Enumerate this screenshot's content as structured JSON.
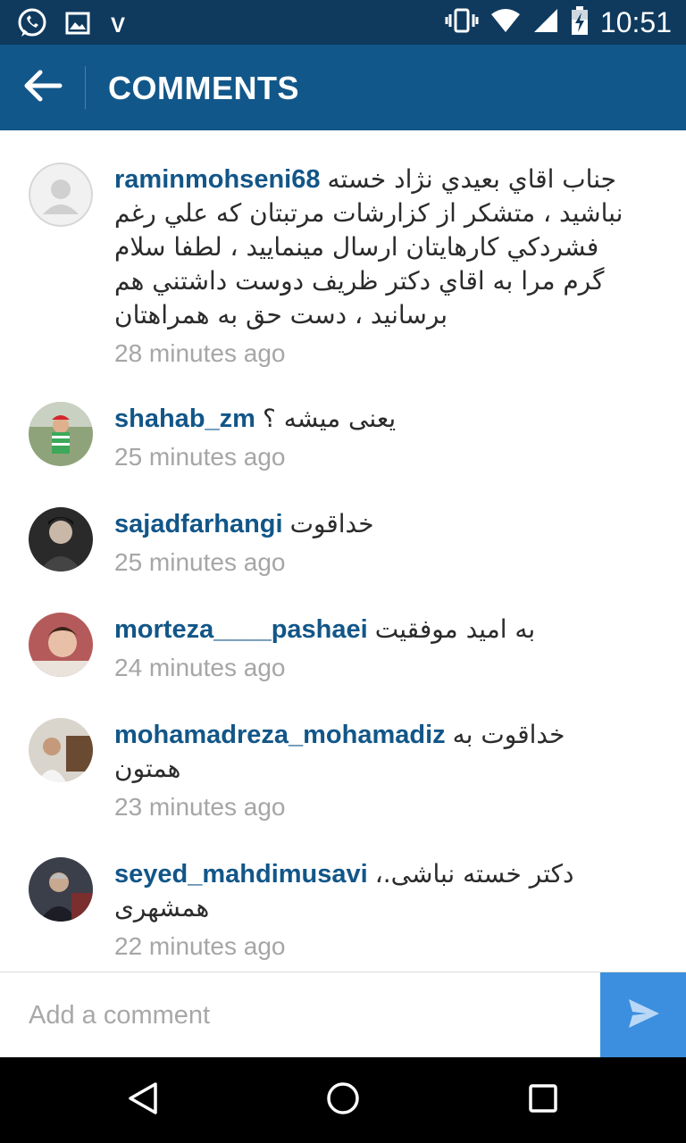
{
  "status_bar": {
    "time": "10:51",
    "carrier_mark": "V",
    "left_icons": [
      "whatsapp-icon",
      "image-icon"
    ],
    "right_icons": [
      "vibrate-icon",
      "wifi-icon",
      "signal-icon",
      "battery-charging-icon"
    ]
  },
  "toolbar": {
    "title": "COMMENTS",
    "back_icon": "arrow-left-icon"
  },
  "comments": [
    {
      "username": "raminmohseni68",
      "text": "جناب اقاي بعيدي نژاد خسته نباشيد ، متشكر از كزارشات مرتبتان كه علي رغم فشردكي كارهايتان ارسال مينماييد ، لطفا سلام گرم مرا به اقاي دكتر ظريف دوست داشتني هم برسانيد ، دست حق به همراهتان",
      "time": "28 minutes ago",
      "avatar": "default-avatar"
    },
    {
      "username": "shahab_zm",
      "text": "یعنی میشه ؟",
      "time": "25 minutes ago",
      "avatar": "child-photo"
    },
    {
      "username": "sajadfarhangi",
      "text": "خداقوت",
      "time": "25 minutes ago",
      "avatar": "man-photo"
    },
    {
      "username": "morteza____pashaei",
      "text": "به امید موفقیت",
      "time": "24 minutes ago",
      "avatar": "child-photo"
    },
    {
      "username": "mohamadreza_mohamadiz",
      "text": "خداقوت به همتون",
      "time": "23 minutes ago",
      "avatar": "man-photo"
    },
    {
      "username": "seyed_mahdimusavi",
      "text": "دکتر خسته نباشی.، همشهری",
      "time": "22 minutes ago",
      "avatar": "man-photo"
    }
  ],
  "composer": {
    "placeholder": "Add a comment",
    "value": "",
    "send_icon": "send-icon"
  },
  "nav_bar": {
    "icons": [
      "back-triangle-icon",
      "home-circle-icon",
      "recents-square-icon"
    ]
  },
  "colors": {
    "status_bar": "#0f3a5e",
    "toolbar": "#12578a",
    "username": "#125688",
    "timestamp": "#a6a6a6",
    "send_button": "#3c8fde"
  }
}
